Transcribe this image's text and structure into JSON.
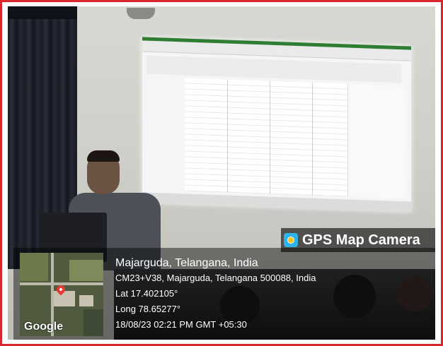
{
  "watermark": {
    "app_name": "GPS Map Camera",
    "map_provider": "Google",
    "place": "Majarguda, Telangana, India",
    "address": "CM23+V38, Majarguda, Telangana 500088, India",
    "latitude": "Lat 17.402105°",
    "longitude": "Long 78.65277°",
    "timestamp": "18/08/23 02:21 PM GMT +05:30"
  },
  "colors": {
    "frame_border": "#d8262d",
    "badge_icon": "#2fb4e8",
    "map_pin": "#e53935"
  },
  "icons": {
    "badge_icon": "gps-camera-app-icon",
    "map_marker": "map-pin-icon"
  }
}
